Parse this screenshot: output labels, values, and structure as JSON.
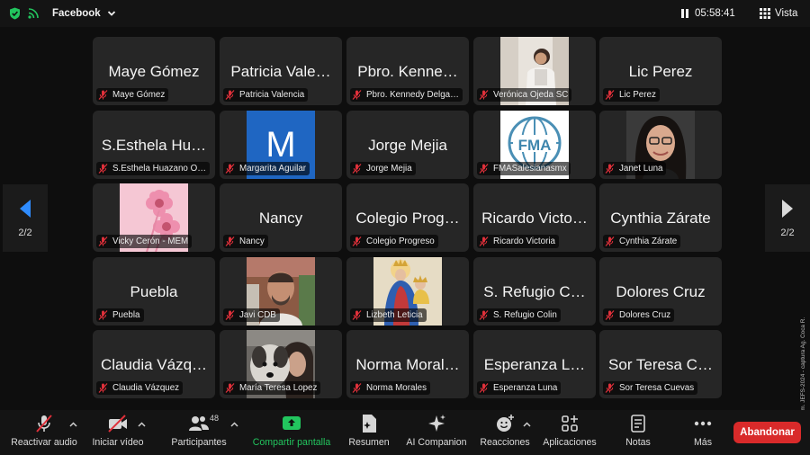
{
  "topbar": {
    "meeting_name": "Facebook",
    "timer": "05:58:41",
    "view_label": "Vista"
  },
  "colors": {
    "background": "#0e0e0e",
    "tile": "#262626",
    "share_green": "#22c55e",
    "leave_red": "#d92a2a",
    "mute_red": "#e0303a",
    "secure_green": "#22c55e"
  },
  "participants": [
    {
      "display": "Maye Gómez",
      "label": "Maye Gómez",
      "type": "name"
    },
    {
      "display": "Patricia Vale…",
      "label": "Patricia Valencia",
      "type": "name"
    },
    {
      "display": "Pbro. Kenne…",
      "label": "Pbro. Kennedy Delga…",
      "type": "name"
    },
    {
      "display": "",
      "label": "Verónica Ojeda SC",
      "type": "photo",
      "photo": "veronica"
    },
    {
      "display": "Lic Perez",
      "label": "Lic Perez",
      "type": "name"
    },
    {
      "display": "S.Esthela Hu…",
      "label": "S.Esthela Huazano O…",
      "type": "name"
    },
    {
      "display": "M",
      "label": "Margarita Aguilar",
      "type": "avatar"
    },
    {
      "display": "Jorge Mejia",
      "label": "Jorge Mejia",
      "type": "name"
    },
    {
      "display": "",
      "label": "FMASalesianasmx",
      "type": "photo",
      "photo": "fma"
    },
    {
      "display": "",
      "label": "Janet Luna",
      "type": "photo",
      "photo": "janet"
    },
    {
      "display": "",
      "label": "Vicky Cerón - MEM",
      "type": "photo",
      "photo": "flowers"
    },
    {
      "display": "Nancy",
      "label": "Nancy",
      "type": "name"
    },
    {
      "display": "Colegio Prog…",
      "label": "Colegio Progreso",
      "type": "name"
    },
    {
      "display": "Ricardo Victo…",
      "label": "Ricardo Victoria",
      "type": "name"
    },
    {
      "display": "Cynthia Zárate",
      "label": "Cynthia Zárate",
      "type": "name"
    },
    {
      "display": "Puebla",
      "label": "Puebla",
      "type": "name"
    },
    {
      "display": "",
      "label": "Javi CDB",
      "type": "photo",
      "photo": "javi"
    },
    {
      "display": "",
      "label": "Lizbeth Leticia",
      "type": "photo",
      "photo": "mary"
    },
    {
      "display": "S. Refugio C…",
      "label": "S. Refugio Colin",
      "type": "name"
    },
    {
      "display": "Dolores Cruz",
      "label": "Dolores Cruz",
      "type": "name"
    },
    {
      "display": "Claudia Vázq…",
      "label": "Claudia Vázquez",
      "type": "name"
    },
    {
      "display": "",
      "label": "María Teresa Lopez",
      "type": "photo",
      "photo": "dog"
    },
    {
      "display": "Norma Moral…",
      "label": "Norma Morales",
      "type": "name"
    },
    {
      "display": "Esperanza L…",
      "label": "Esperanza Luna",
      "type": "name"
    },
    {
      "display": "Sor Teresa C…",
      "label": "Sor Teresa Cuevas",
      "type": "name"
    }
  ],
  "pagination": {
    "left": "2/2",
    "right": "2/2"
  },
  "side_caption": "Cortesía © Zoom. JEFS-2024 - captura Ag. Coca R.",
  "toolbar": {
    "audio": "Reactivar audio",
    "video": "Iniciar vídeo",
    "participants": "Participantes",
    "participants_count": "48",
    "share": "Compartir pantalla",
    "summary": "Resumen",
    "ai": "AI Companion",
    "reactions": "Reacciones",
    "apps": "Aplicaciones",
    "notes": "Notas",
    "more": "Más",
    "leave": "Abandonar"
  }
}
